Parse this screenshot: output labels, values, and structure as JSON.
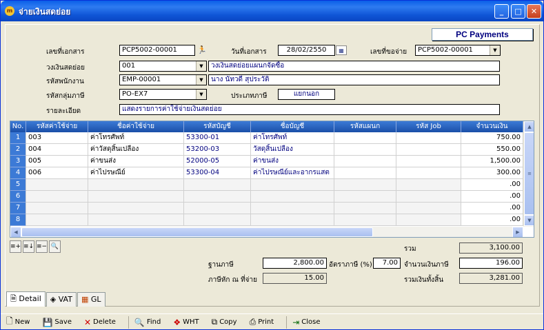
{
  "window": {
    "title": "จ่ายเงินสดย่อย",
    "icon_text": "m"
  },
  "badge": "PC Payments",
  "form": {
    "doc_no_label": "เลขที่เอกสาร",
    "doc_no": "PCP5002-00001",
    "doc_date_label": "วันที่เอกสาร",
    "doc_date": "28/02/2550",
    "ref_label": "เลขที่ขอจ่าย",
    "ref_no": "PCP5002-00001",
    "fund_label": "วงเงินสดย่อย",
    "fund_code": "001",
    "fund_name": "วงเงินสดย่อยแผนกจัดซื้อ",
    "emp_label": "รหัสพนักงาน",
    "emp_code": "EMP-00001",
    "emp_name": "นาง นัทวดี สุประวัติ",
    "taxgroup_label": "รหัสกลุ่มภาษี",
    "taxgroup_code": "PO-EX7",
    "taxtype_label": "ประเภทภาษี",
    "taxtype_value": "แยกนอก",
    "detail_label": "รายละเอียด",
    "detail_value": "แสดงรายการค่าใช้จ่ายเงินสดย่อย"
  },
  "grid": {
    "headers": [
      "No.",
      "รหัสค่าใช้จ่าย",
      "ชื่อค่าใช้จ่าย",
      "รหัสบัญชี",
      "ชื่อบัญชี",
      "รหัสแผนก",
      "รหัส Job",
      "จำนวนเงิน"
    ],
    "rows": [
      {
        "no": "1",
        "code": "003",
        "name": "ค่าโทรศัพท์",
        "acct": "53300-01",
        "acct_name": "ค่าโทรศัพท์",
        "dept": "",
        "job": "",
        "amount": "750.00"
      },
      {
        "no": "2",
        "code": "004",
        "name": "ค่าวัสดุสิ้นเปลือง",
        "acct": "53200-03",
        "acct_name": "วัสดุสิ้นเปลือง",
        "dept": "",
        "job": "",
        "amount": "550.00"
      },
      {
        "no": "3",
        "code": "005",
        "name": "ค่าขนส่ง",
        "acct": "52000-05",
        "acct_name": "ค่าขนส่ง",
        "dept": "",
        "job": "",
        "amount": "1,500.00"
      },
      {
        "no": "4",
        "code": "006",
        "name": "ค่าไปรษณีย์",
        "acct": "53300-04",
        "acct_name": "ค่าไปรษณีย์และอากรแสต",
        "dept": "",
        "job": "",
        "amount": "300.00"
      },
      {
        "no": "5",
        "code": "",
        "name": "",
        "acct": "",
        "acct_name": "",
        "dept": "",
        "job": "",
        "amount": ".00"
      },
      {
        "no": "6",
        "code": "",
        "name": "",
        "acct": "",
        "acct_name": "",
        "dept": "",
        "job": "",
        "amount": ".00"
      },
      {
        "no": "7",
        "code": "",
        "name": "",
        "acct": "",
        "acct_name": "",
        "dept": "",
        "job": "",
        "amount": ".00"
      },
      {
        "no": "8",
        "code": "",
        "name": "",
        "acct": "",
        "acct_name": "",
        "dept": "",
        "job": "",
        "amount": ".00"
      }
    ]
  },
  "totals": {
    "total_label": "รวม",
    "total": "3,100.00",
    "base_label": "ฐานภาษี",
    "base": "2,800.00",
    "rate_label": "อัตราภาษี (%)",
    "rate": "7.00",
    "tax_label": "จำนวนเงินภาษี",
    "tax": "196.00",
    "wht_label": "ภาษีหัก ณ ที่จ่าย",
    "wht": "15.00",
    "grand_label": "รวมเงินทั้งสิ้น",
    "grand": "3,281.00"
  },
  "tabs": [
    {
      "label": "Detail"
    },
    {
      "label": "VAT"
    },
    {
      "label": "GL"
    }
  ],
  "toolbar": {
    "new": "New",
    "save": "Save",
    "delete": "Delete",
    "find": "Find",
    "wht": "WHT",
    "copy": "Copy",
    "print": "Print",
    "close": "Close"
  }
}
